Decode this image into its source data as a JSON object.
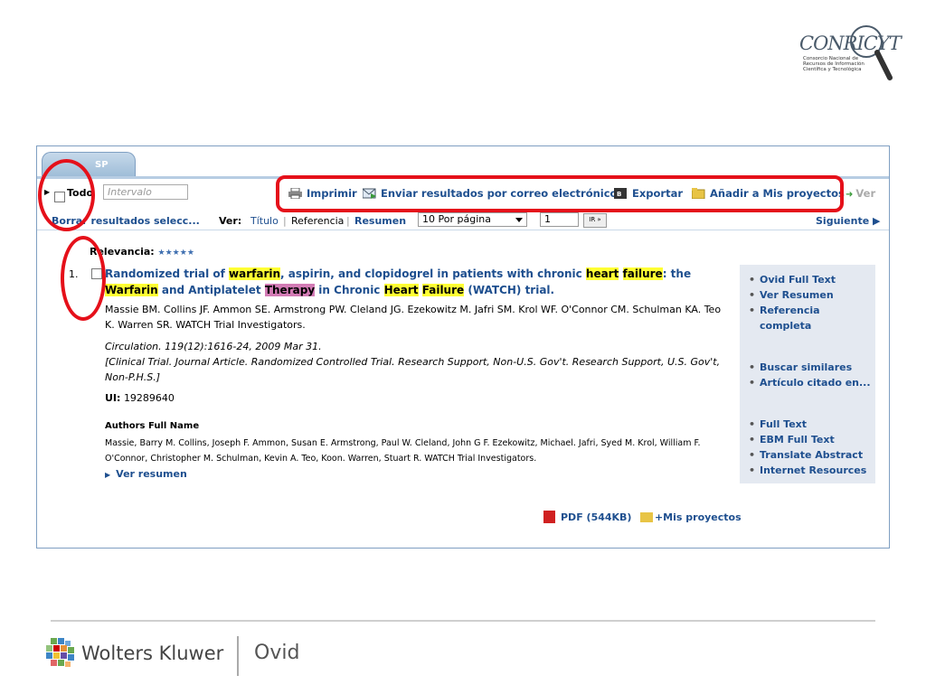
{
  "logo": {
    "name": "CONRICYT",
    "subtitle": "Consorcio Nacional de Recursos de Información Científica y Tecnológica"
  },
  "tab": {
    "label": "SP"
  },
  "toolbar": {
    "select_all_label": "Todo",
    "range_placeholder": "Intervalo",
    "print": "Imprimir",
    "email": "Enviar resultados por correo electrónico",
    "export": "Exportar",
    "add_projects": "Añadir a Mis proyectos",
    "view": "Ver"
  },
  "toolbar2": {
    "clear": "Borrar resultados selecc...",
    "view_label": "Ver:",
    "view_title": "Título",
    "view_reference": "Referencia",
    "view_summary": "Resumen",
    "per_page": "10 Por página",
    "page_number": "1",
    "go": "IR »",
    "next": "Siguiente ▶"
  },
  "result": {
    "relevance_label": "Relevancia:",
    "relevance_stars": "★★★★★",
    "number": "1.",
    "title_parts": [
      "Randomized trial of ",
      "warfarin",
      ", aspirin, and clopidogrel in patients with chronic ",
      "heart",
      " ",
      "failure",
      ": the ",
      "Warfarin",
      " and Antiplatelet ",
      "Therapy",
      " in Chronic ",
      "Heart",
      " ",
      "Failure",
      " (WATCH) trial."
    ],
    "authors": "Massie BM. Collins JF. Ammon SE. Armstrong PW. Cleland JG. Ezekowitz M. Jafri SM. Krol WF. O'Connor CM. Schulman KA. Teo K. Warren SR. WATCH Trial Investigators.",
    "citation": "Circulation. 119(12):1616-24, 2009 Mar 31.",
    "pubtype": "[Clinical Trial. Journal Article. Randomized Controlled Trial. Research Support, Non-U.S. Gov't. Research Support, U.S. Gov't, Non-P.H.S.]",
    "ui_label": "UI:",
    "ui_value": "19289640",
    "afn_heading": "Authors Full Name",
    "afn": "Massie, Barry M. Collins, Joseph F. Ammon, Susan E. Armstrong, Paul W. Cleland, John G F. Ezekowitz, Michael. Jafri, Syed M. Krol, William F. O'Connor, Christopher M. Schulman, Kevin A. Teo, Koon. Warren, Stuart R. WATCH Trial Investigators.",
    "view_abstract": "Ver resumen",
    "pdf": "PDF (544KB)",
    "my_projects": "+Mis proyectos"
  },
  "sidebar": {
    "links": [
      "Ovid Full Text",
      "Ver Resumen",
      "Referencia completa",
      "Buscar similares",
      "Artículo citado en...",
      "Full Text",
      "EBM Full Text",
      "Translate Abstract",
      "Internet Resources"
    ]
  },
  "footer": {
    "brand": "Wolters Kluwer",
    "product": "Ovid"
  },
  "colors": {
    "link": "#1e4f8f",
    "annotation": "#e5101a",
    "highlight": "#ffff33",
    "highlight_pink": "#d37bb5"
  }
}
